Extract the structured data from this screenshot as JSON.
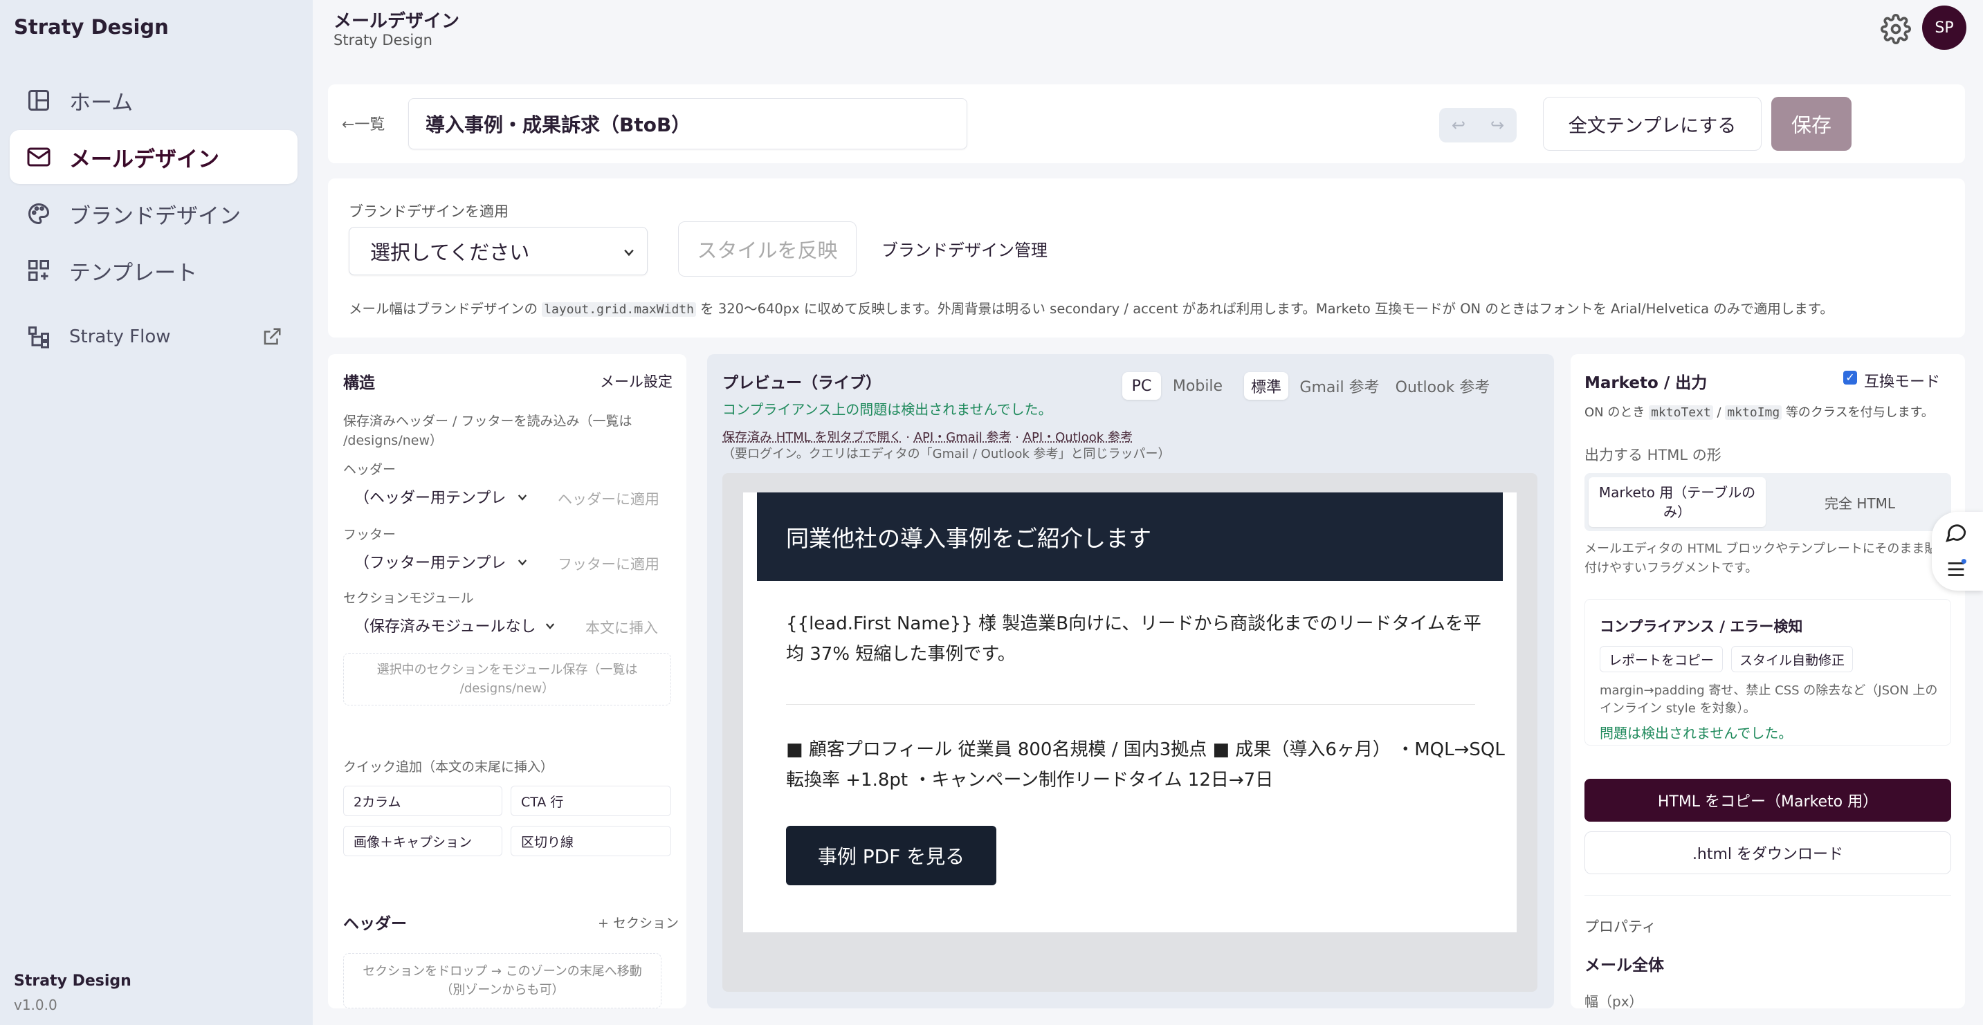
{
  "sidebar": {
    "brand": "Straty Design",
    "items": [
      {
        "label": "ホーム",
        "icon": "home-layout-icon"
      },
      {
        "label": "メールデザイン",
        "icon": "mail-icon",
        "active": true
      },
      {
        "label": "ブランドデザイン",
        "icon": "palette-icon"
      },
      {
        "label": "テンプレート",
        "icon": "template-grid-icon"
      },
      {
        "label": "Straty Flow",
        "icon": "flow-icon",
        "external": true
      }
    ],
    "footer_name": "Straty Design",
    "footer_version": "v1.0.0"
  },
  "header": {
    "title": "メールデザイン",
    "subtitle": "Straty Design",
    "avatar": "SP"
  },
  "topbar": {
    "back_label": "←一覧",
    "title_value": "導入事例・成果訴求（BtoB）",
    "undo": "↩",
    "redo": "↪",
    "template_button": "全文テンプレにする",
    "save_button": "保存"
  },
  "brand_bar": {
    "label": "ブランドデザインを適用",
    "select_value": "選択してください",
    "apply_button": "スタイルを反映",
    "manage_link": "ブランドデザイン管理",
    "note_pre": "メール幅はブランドデザインの",
    "note_code": "layout.grid.maxWidth",
    "note_post": "を 320〜640px に収めて反映します。外周背景は明るい secondary / accent があれば利用します。Marketo 互換モードが ON のときはフォントを Arial/Helvetica のみで適用します。"
  },
  "structure": {
    "title": "構造",
    "settings_link": "メール設定",
    "load_note": "保存済みヘッダー / フッターを読み込み（一覧は /designs/new）",
    "header_label": "ヘッダー",
    "header_select": "（ヘッダー用テンプレ",
    "header_apply": "ヘッダーに適用",
    "footer_label": "フッター",
    "footer_select": "（フッター用テンプレ",
    "footer_apply": "フッターに適用",
    "module_label": "セクションモジュール",
    "module_select": "（保存済みモジュールなし",
    "module_insert": "本文に挿入",
    "save_module": "選択中のセクションをモジュール保存（一覧は /designs/new）",
    "quick_label": "クイック追加（本文の末尾に挿入）",
    "quick": [
      "2カラム",
      "CTA 行",
      "画像＋キャプション",
      "区切り線"
    ],
    "zone_title": "ヘッダー",
    "zone_add": "+ セクション",
    "zone_drop": "セクションをドロップ → このゾーンの末尾へ移動（別ゾーンからも可）"
  },
  "preview": {
    "title": "プレビュー（ライブ）",
    "ok_msg": "コンプライアンス上の問題は検出されませんでした。",
    "device_tabs": [
      "PC",
      "Mobile"
    ],
    "mode_tabs": [
      "標準",
      "Gmail 参考",
      "Outlook 参考"
    ],
    "link1": "保存済み HTML を別タブで開く",
    "link2": "API・Gmail 参考",
    "link3": "API・Outlook 参考",
    "sep": "·",
    "login_note": "（要ログイン。クエリはエディタの「Gmail / Outlook 参考」と同じラッパー）",
    "mail": {
      "heading": "同業他社の導入事例をご紹介します",
      "intro_l1": "{{lead.First Name}} 様 製造業B向けに、リードから商談化までのリードタイムを平",
      "intro_l2": "均 37% 短縮した事例です。",
      "body_l1": "■ 顧客プロフィール 従業員 800名規模 / 国内3拠点 ■ 成果（導入6ヶ月） ・MQL→SQL",
      "body_l2": "転換率 +1.8pt ・キャンペーン制作リードタイム 12日→7日",
      "cta": "事例 PDF を見る"
    }
  },
  "output": {
    "title": "Marketo / 出力",
    "compat_label": "互換モード",
    "compat_checked": true,
    "compat_note_pre": "ON のとき",
    "compat_code1": "mktoText",
    "compat_slash": "/",
    "compat_code2": "mktoImg",
    "compat_note_post": "等のクラスを付与します。",
    "shape_label": "出力する HTML の形",
    "shape_opt1": "Marketo 用（テーブルのみ）",
    "shape_opt2": "完全 HTML",
    "shape_note": "メールエディタの HTML ブロックやテンプレートにそのまま貼り付けやすいフラグメントです。",
    "compliance_title": "コンプライアンス / エラー検知",
    "copy_report": "レポートをコピー",
    "auto_fix": "スタイル自動修正",
    "compliance_note": "margin→padding 寄せ、禁止 CSS の除去など（JSON 上のインライン style を対象）。",
    "compliance_ok": "問題は検出されませんでした。",
    "copy_html": "HTML をコピー（Marketo 用）",
    "download": ".html をダウンロード",
    "props_label": "プロパティ",
    "props_section": "メール全体",
    "props_width": "幅（px）"
  },
  "colors": {
    "accent": "#3b0a2a",
    "save_disabled": "#a48d9a",
    "mail_header": "#1b2536",
    "success": "#1f8a5c"
  }
}
